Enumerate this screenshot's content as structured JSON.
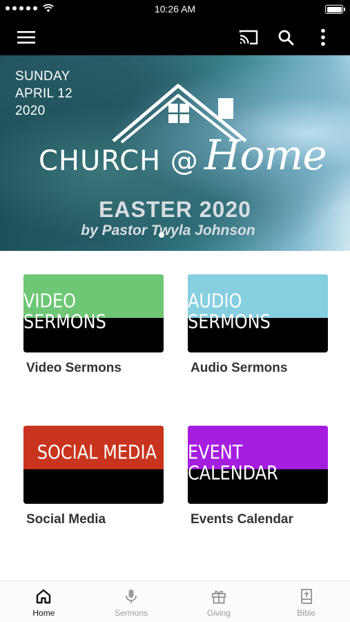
{
  "status_bar": {
    "time": "10:26 AM",
    "signal_icon": "signal-dots-icon",
    "wifi_icon": "wifi-icon",
    "battery_icon": "battery-icon"
  },
  "app_bar": {
    "menu_icon": "hamburger-menu-icon",
    "cast_icon": "cast-icon",
    "search_icon": "search-icon",
    "more_icon": "more-vertical-icon"
  },
  "hero": {
    "date_line1": "SUNDAY",
    "date_line2": "APRIL 12",
    "date_line3": "2020",
    "title_left": "CHURCH @",
    "title_right": "Home",
    "subtitle": "EASTER 2020",
    "byline": "by  Pastor Twyla Johnson"
  },
  "tiles": [
    {
      "banner": "VIDEO SERMONS",
      "label": "Video Sermons",
      "color": "#6dc774"
    },
    {
      "banner": "AUDIO SERMONS",
      "label": "Audio Sermons",
      "color": "#86cfe0"
    },
    {
      "banner": "SOCIAL MEDIA",
      "label": "Social Media",
      "color": "#c8341d"
    },
    {
      "banner": "EVENT CALENDAR",
      "label": "Events Calendar",
      "color": "#a51ee0"
    }
  ],
  "bottom_nav": [
    {
      "label": "Home",
      "icon": "home-icon",
      "active": true
    },
    {
      "label": "Sermons",
      "icon": "microphone-icon",
      "active": false
    },
    {
      "label": "Giving",
      "icon": "gift-icon",
      "active": false
    },
    {
      "label": "Bible",
      "icon": "bible-icon",
      "active": false
    }
  ]
}
